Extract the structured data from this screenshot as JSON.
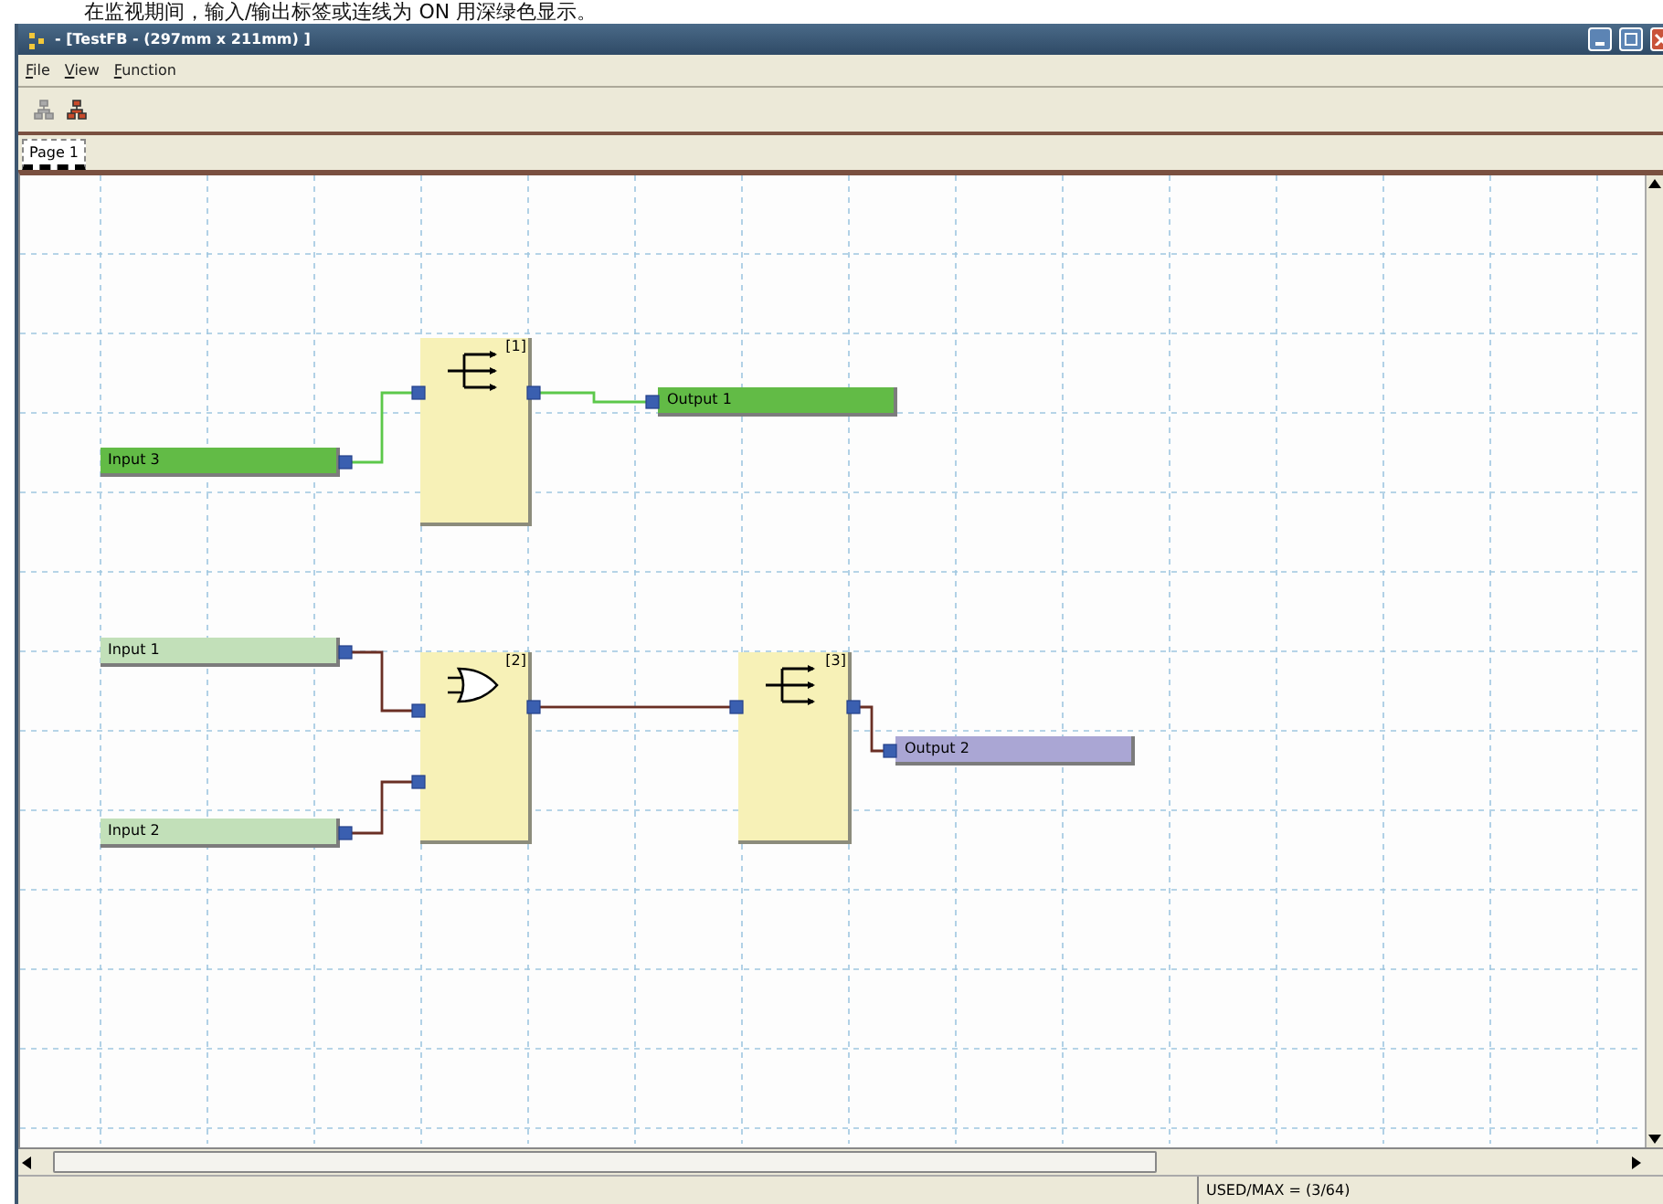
{
  "caption": "在监视期间，输入/输出标签或连线为 ON 用深绿色显示。",
  "window": {
    "title": "- [TestFB - (297mm x 211mm) ]"
  },
  "menu": [
    "File",
    "View",
    "Function"
  ],
  "tabs": [
    {
      "label": "Page 1",
      "selected": true
    }
  ],
  "diagram": {
    "tags": [
      {
        "kind": "output",
        "label": "Output 1",
        "on": true
      },
      {
        "kind": "input",
        "label": "Input 3",
        "on": true
      },
      {
        "kind": "input",
        "label": "Input 1",
        "on": false
      },
      {
        "kind": "input",
        "label": "Input 2",
        "on": false
      },
      {
        "kind": "output",
        "label": "Output 2",
        "on": false
      }
    ],
    "blocks": [
      {
        "kind": "split",
        "number": "[1]"
      },
      {
        "kind": "or",
        "number": "[2]"
      },
      {
        "kind": "split",
        "number": "[3]"
      }
    ],
    "wires": [
      {
        "on": true
      },
      {
        "on": true
      },
      {
        "on": false
      },
      {
        "on": false
      },
      {
        "on": false
      },
      {
        "on": false
      }
    ]
  },
  "status_bar": {
    "usage": "USED/MAX = (3/64)"
  }
}
